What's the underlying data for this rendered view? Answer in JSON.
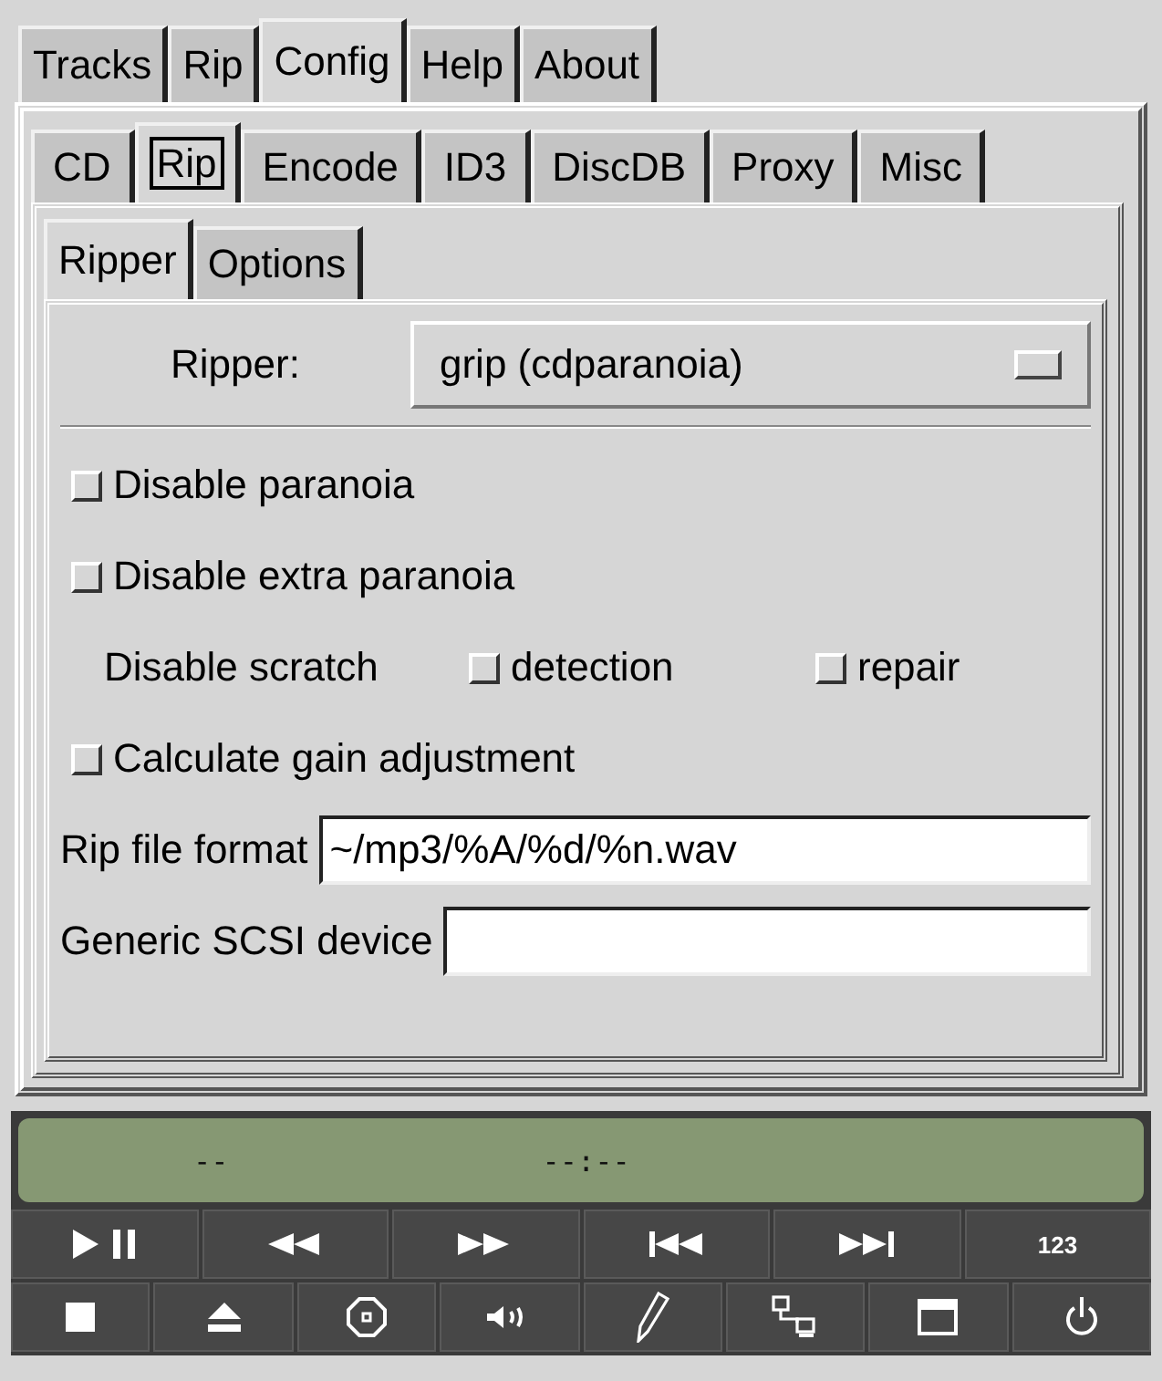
{
  "main_tabs": [
    {
      "label": "Tracks",
      "selected": false
    },
    {
      "label": "Rip",
      "selected": false
    },
    {
      "label": "Config",
      "selected": true
    },
    {
      "label": "Help",
      "selected": false
    },
    {
      "label": "About",
      "selected": false
    }
  ],
  "config_tabs": [
    {
      "label": "CD",
      "selected": false,
      "focused": false
    },
    {
      "label": "Rip",
      "selected": true,
      "focused": true
    },
    {
      "label": "Encode",
      "selected": false,
      "focused": false
    },
    {
      "label": "ID3",
      "selected": false,
      "focused": false
    },
    {
      "label": "DiscDB",
      "selected": false,
      "focused": false
    },
    {
      "label": "Proxy",
      "selected": false,
      "focused": false
    },
    {
      "label": "Misc",
      "selected": false,
      "focused": false
    }
  ],
  "rip_tabs": [
    {
      "label": "Ripper",
      "selected": true
    },
    {
      "label": "Options",
      "selected": false
    }
  ],
  "ripper": {
    "label": "Ripper:",
    "value": "grip (cdparanoia)"
  },
  "options": [
    {
      "kind": "checkbox",
      "label": "Disable paranoia",
      "checked": false
    },
    {
      "kind": "checkbox",
      "label": "Disable extra paranoia",
      "checked": false
    },
    {
      "kind": "group",
      "label": "Disable scratch",
      "items": [
        {
          "label": "detection",
          "checked": false
        },
        {
          "label": "repair",
          "checked": false
        }
      ]
    },
    {
      "kind": "checkbox",
      "label": "Calculate gain adjustment",
      "checked": false
    }
  ],
  "fields": [
    {
      "label": "Rip file format",
      "value": "~/mp3/%A/%d/%n.wav"
    },
    {
      "label": "Generic SCSI device"
    }
  ],
  "display": {
    "track": "--",
    "time": "--:--"
  },
  "number_button": "123"
}
